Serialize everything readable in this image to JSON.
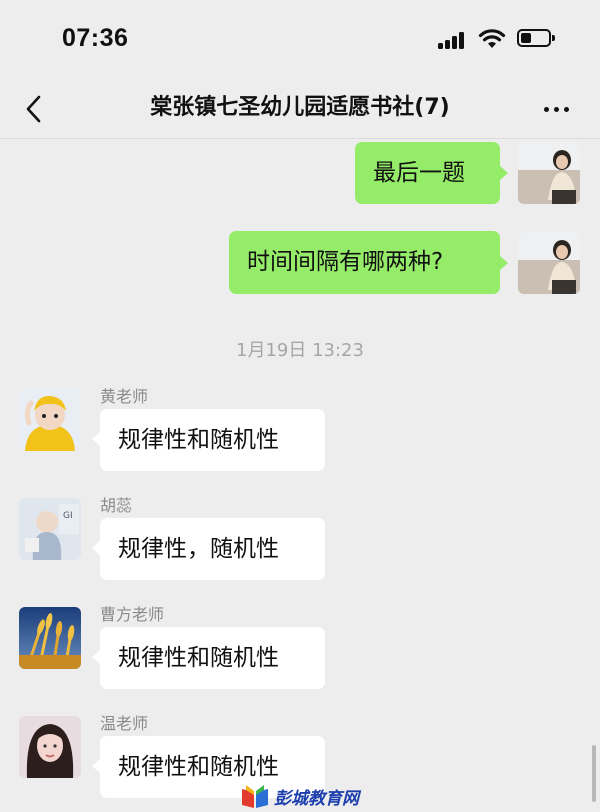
{
  "status_bar": {
    "time": "07:36"
  },
  "header": {
    "title": "棠张镇七圣幼儿园适愿书社(7)",
    "back_icon": "chevron-left-icon",
    "more_icon": "more-dots-icon"
  },
  "messages_out": [
    {
      "text": "最后一题"
    },
    {
      "text": "时间间隔有哪两种?"
    }
  ],
  "timestamp": "1月19日 13:23",
  "messages_in": [
    {
      "sender": "黄老师",
      "text": "规律性和随机性"
    },
    {
      "sender": "胡蕊",
      "text": "规律性，随机性"
    },
    {
      "sender": "曹方老师",
      "text": "规律性和随机性"
    },
    {
      "sender": "温老师",
      "text": "规律性和随机性"
    }
  ],
  "watermark": {
    "text": "彭城教育网"
  },
  "colors": {
    "background": "#ededed",
    "outgoing_bubble": "#95ec69",
    "incoming_bubble": "#ffffff",
    "watermark": "#1d3fae"
  }
}
